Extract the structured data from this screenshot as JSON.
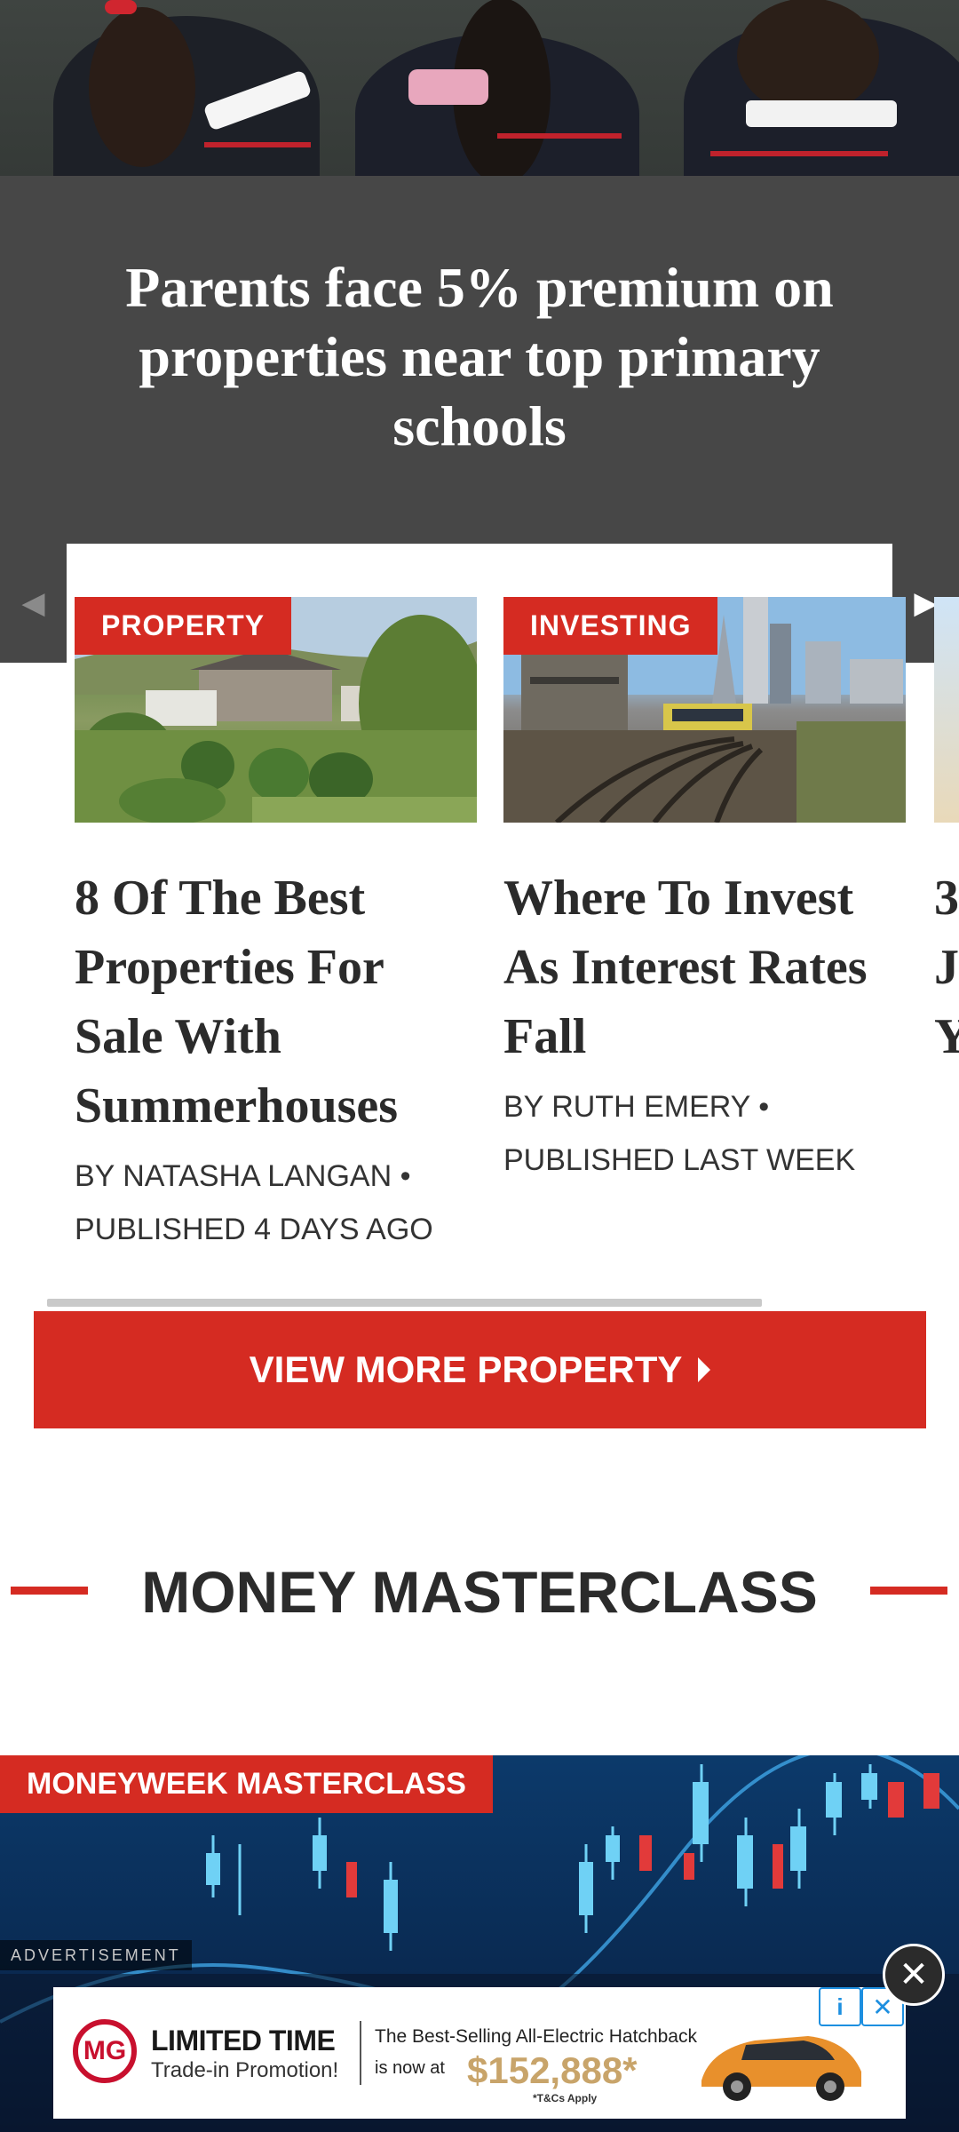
{
  "hero": {
    "title": "Parents face 5% premium on properties near top primary schools"
  },
  "carousel": {
    "prev_icon": "◀",
    "next_icon": "▶",
    "cards": [
      {
        "tag": "PROPERTY",
        "title": "8 Of The Best Properties For Sale With Summerhouses",
        "byline": "BY NATASHA LANGAN • PUBLISHED 4 DAYS AGO"
      },
      {
        "tag": "INVESTING",
        "title": "Where To Invest As Interest Rates Fall",
        "byline": "BY RUTH EMERY • PUBLISHED LAST WEEK"
      }
    ],
    "peek_text": "3 J Y",
    "scroll_position": 0.0
  },
  "view_more": {
    "label": "VIEW MORE PROPERTY"
  },
  "section": {
    "title": "MONEY MASTERCLASS"
  },
  "masterclass": {
    "tag": "MONEYWEEK MASTERCLASS"
  },
  "ad": {
    "label": "ADVERTISEMENT",
    "brand": "MG",
    "headline": "LIMITED TIME",
    "subheadline": "Trade-in Promotion!",
    "copy": "The Best-Selling All-Electric Hatchback",
    "now_at": "is now at",
    "price": "$152,888*",
    "tnc": "*T&Cs Apply",
    "info_icon": "i",
    "x_icon": "✕",
    "close_icon": "✕"
  },
  "colors": {
    "accent_red": "#d52b22",
    "hero_band": "#474747",
    "headline_text": "#2b2b2b"
  }
}
